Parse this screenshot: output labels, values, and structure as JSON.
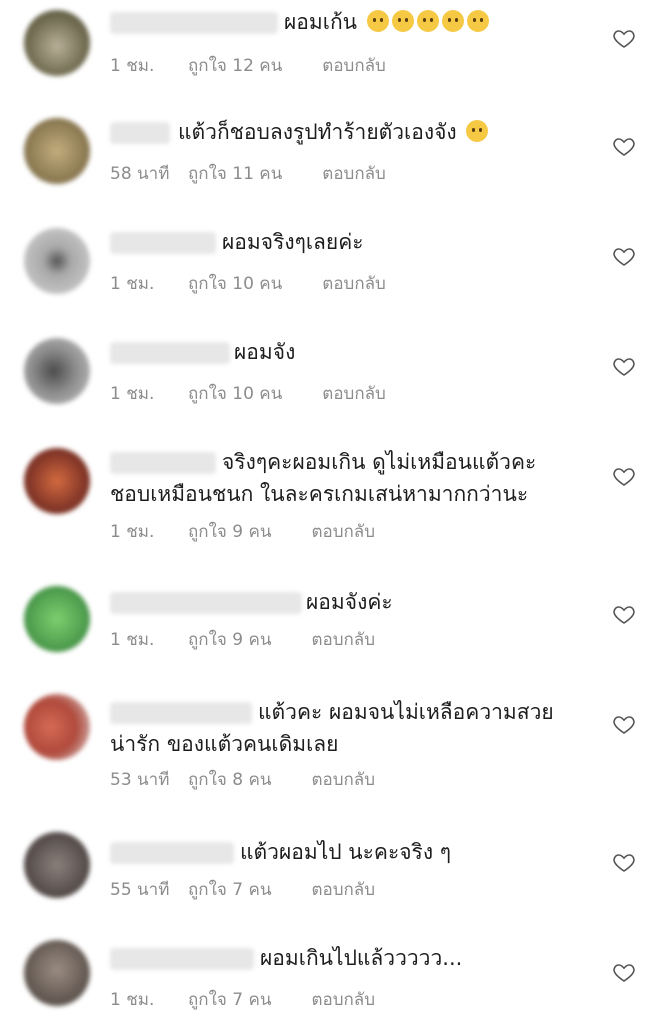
{
  "comments": [
    {
      "text": "ผอมเก้น",
      "emoji_count": 5,
      "time": "1 ชม.",
      "likes": "ถูกใจ 12 คน",
      "reply": "ตอบกลับ",
      "avatar_color": "#6f6a4f"
    },
    {
      "text": "แต้วก็ชอบลงรูปทำร้ายตัวเองจัง",
      "emoji_count": 1,
      "time": "58 นาที",
      "likes": "ถูกใจ 11 คน",
      "reply": "ตอบกลับ",
      "avatar_color": "#8e7c54"
    },
    {
      "text": "ผอมจริงๆเลยค่ะ",
      "time": "1 ชม.",
      "likes": "ถูกใจ 10 คน",
      "reply": "ตอบกลับ",
      "avatar_color": "#a9a9a9"
    },
    {
      "text": "ผอมจัง",
      "time": "1 ชม.",
      "likes": "ถูกใจ 10 คน",
      "reply": "ตอบกลับ",
      "avatar_color": "#8d8d8d"
    },
    {
      "text": "จริงๆคะผอมเกิน ดูไม่เหมือนแต้วคะ",
      "text_line2": "ชอบเหมือนชนก ในละครเกมเสน่หามากกว่านะ",
      "time": "1 ชม.",
      "likes": "ถูกใจ 9 คน",
      "reply": "ตอบกลับ",
      "avatar_color": "#8a3a2a"
    },
    {
      "text": "ผอมจังค่ะ",
      "time": "1 ชม.",
      "likes": "ถูกใจ 9 คน",
      "reply": "ตอบกลับ",
      "avatar_color": "#4f9e4f"
    },
    {
      "text": "แต้วคะ ผอมจนไม่เหลือความสวย",
      "text_line2": "น่ารัก ของแต้วคนเดิมเลย",
      "time": "53 นาที",
      "likes": "ถูกใจ 8 คน",
      "reply": "ตอบกลับ",
      "avatar_color": "#b04a3c"
    },
    {
      "text": "แต้วผอมไป นะคะจริง ๆ",
      "time": "55 นาที",
      "likes": "ถูกใจ 7 คน",
      "reply": "ตอบกลับ",
      "avatar_color": "#5d5452"
    },
    {
      "text": "ผอมเกินไปแล้ววววว...",
      "time": "1 ชม.",
      "likes": "ถูกใจ 7 คน",
      "reply": "ตอบกลับ",
      "avatar_color": "#6a5f58"
    }
  ]
}
